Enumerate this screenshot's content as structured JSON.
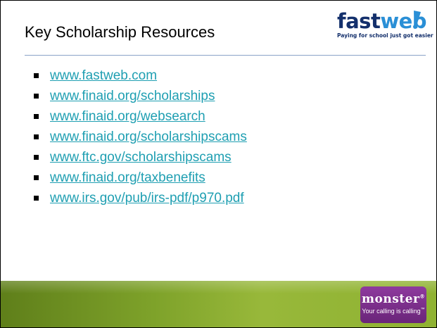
{
  "slide": {
    "title": "Key Scholarship Resources"
  },
  "logo": {
    "word_dark": "fast",
    "word_light": "web",
    "tagline": "Paying for school just got easier"
  },
  "links": [
    {
      "text": "www.fastweb.com"
    },
    {
      "text": "www.finaid.org/scholarships"
    },
    {
      "text": "www.finaid.org/websearch"
    },
    {
      "text": "www.finaid.org/scholarshipscams"
    },
    {
      "text": "www.ftc.gov/scholarshipscams"
    },
    {
      "text": "www.finaid.org/taxbenefits"
    },
    {
      "text": "www.irs.gov/pub/irs-pdf/p970.pdf"
    }
  ],
  "footer": {
    "brand": "monster",
    "brand_mark": "®",
    "tagline": "Your calling is calling",
    "tagline_mark": "™"
  },
  "colors": {
    "link": "#1f9fb2",
    "fastweb_dark": "#14306c",
    "fastweb_light": "#2a8fd6",
    "footer_green": "#7ea22a",
    "monster_purple": "#7a2d8a"
  }
}
